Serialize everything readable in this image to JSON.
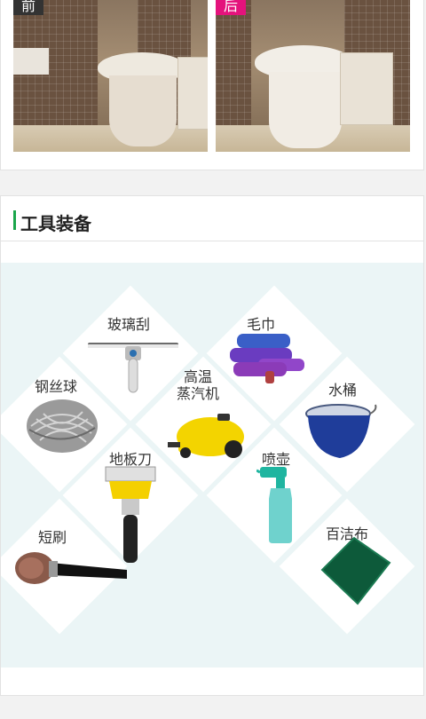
{
  "comparison": {
    "before_label": "前",
    "after_label": "后"
  },
  "section": {
    "title": "工具装备"
  },
  "tools": [
    {
      "id": "squeegee",
      "label": "玻璃刮",
      "icon": "squeegee-icon"
    },
    {
      "id": "towel",
      "label": "毛巾",
      "icon": "towel-icon"
    },
    {
      "id": "steel-wool",
      "label": "钢丝球",
      "icon": "steel-wool-icon"
    },
    {
      "id": "steam-cleaner",
      "label": "高温\n蒸汽机",
      "icon": "steam-cleaner-icon"
    },
    {
      "id": "bucket",
      "label": "水桶",
      "icon": "bucket-icon"
    },
    {
      "id": "scraper",
      "label": "地板刀",
      "icon": "scraper-icon"
    },
    {
      "id": "spray-bottle",
      "label": "喷壶",
      "icon": "spray-bottle-icon"
    },
    {
      "id": "short-brush",
      "label": "短刷",
      "icon": "short-brush-icon"
    },
    {
      "id": "scouring-pad",
      "label": "百洁布",
      "icon": "scouring-pad-icon"
    }
  ],
  "colors": {
    "accent_green": "#1aa64b",
    "after_tag": "#e4137c",
    "before_tag": "#333333",
    "tools_background": "#ebf5f6"
  }
}
